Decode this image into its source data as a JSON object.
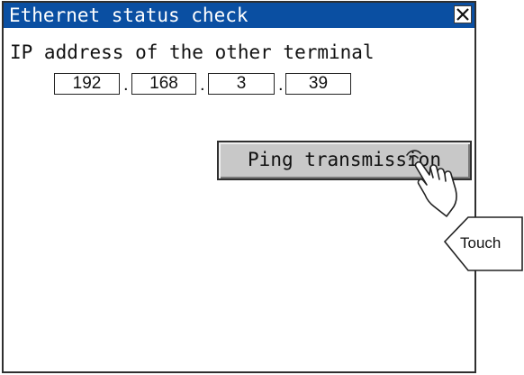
{
  "window": {
    "title": "Ethernet status check",
    "close_glyph": "✕"
  },
  "ip": {
    "label": "IP address of the other terminal",
    "octets": [
      "192",
      "168",
      "3",
      "39"
    ],
    "separator": "."
  },
  "ping_button": {
    "label": "Ping transmission"
  },
  "annotation": {
    "label": "Touch"
  },
  "colors": {
    "titlebar": "#0a4fa2",
    "button_face": "#c8c8c8",
    "border": "#2f2f2f",
    "background": "#ffffff"
  },
  "icons": [
    "close-icon",
    "hand-pointer-icon"
  ]
}
